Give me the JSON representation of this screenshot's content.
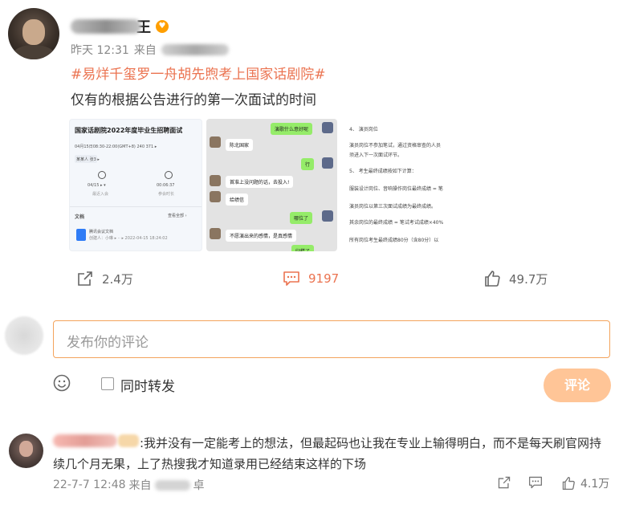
{
  "post": {
    "author_suffix": "王",
    "time": "昨天 12:31",
    "source_label": "来自",
    "hashtag": "#易烊千玺罗一舟胡先煦考上国家话剧院#",
    "text": "仅有的根据公告进行的第一次面试的时间",
    "images": [
      {
        "title": "国家话剧院2022年度毕业生招聘面试",
        "line1": "04月15日08:30-22:00(GMT+8)  240 371 ▸",
        "line2": "某某人   张3 ▸",
        "stat1": "04/15 ▸ ▾",
        "stat1_label": "最近入会",
        "stat2": "00:06:37",
        "stat2_label": "参会时长",
        "docs_label": "文档",
        "docs_more": "查看全部 ›",
        "doc_name": "腾讯会议文档",
        "doc_meta": "创建人：小琳 ▸ ·· ▸ 2022-04-15 18:24:02"
      },
      {
        "chat": [
          {
            "side": "r",
            "text": "演歌什么意好呢"
          },
          {
            "side": "l",
            "text": "陈北国家"
          },
          {
            "side": "r",
            "text": "行"
          },
          {
            "side": "l",
            "text": "首准上没问题的话，去投入!"
          },
          {
            "side": "l",
            "text": "给绩信"
          },
          {
            "side": "r",
            "text": "哪位了"
          },
          {
            "side": "l",
            "text": "不愿演出来的感情，是真感情"
          },
          {
            "side": "r",
            "text": "归楼了"
          }
        ]
      },
      {
        "lines": [
          "4、 演员岗位",
          "演员岗位不参加笔试，通过资格审查的人员",
          "须进入下一次面试环节。",
          "5、 考生最终成绩按如下计算：",
          "服装设计岗位、音响操作岗位最终成绩 = 笔",
          "演员岗位以第三次面试成绩为最终成绩。",
          "其余岗位的最终成绩 = 笔试考试成绩×40%",
          "所有岗位考生最终成绩80分（含80分）以"
        ]
      }
    ],
    "actions": {
      "share": "2.4万",
      "comment": "9197",
      "like": "49.7万"
    }
  },
  "comment_box": {
    "placeholder": "发布你的评论",
    "repost_label": "同时转发",
    "submit_label": "评论"
  },
  "comments": [
    {
      "text": ":我并没有一定能考上的想法，但最起码也让我在专业上输得明白，而不是每天刷官网持续几个月无果，上了热搜我才知道录用已经结束这样的下场",
      "time": "22-7-7 12:48",
      "source_label": "来自",
      "source_suffix": "卓",
      "like": "4.1万"
    }
  ],
  "colors": {
    "accent": "#eb7350",
    "input_border": "#f3a35c",
    "submit_bg": "#ffc597"
  }
}
